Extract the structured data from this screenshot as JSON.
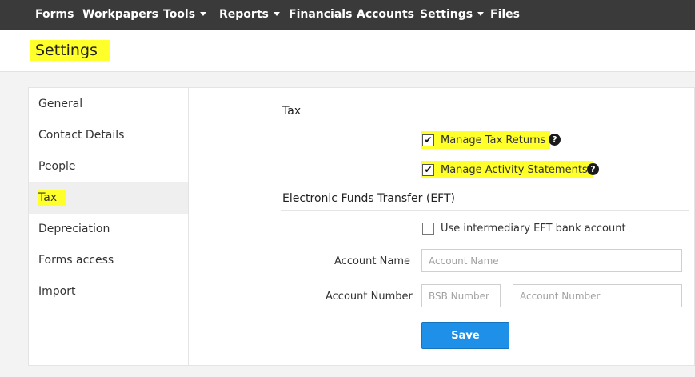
{
  "nav": {
    "forms": "Forms",
    "workpapers": "Workpapers",
    "tools": "Tools",
    "reports": "Reports",
    "financials": "Financials",
    "accounts": "Accounts",
    "settings": "Settings",
    "files": "Files"
  },
  "page": {
    "title": "Settings"
  },
  "sidebar": {
    "items": [
      {
        "label": "General"
      },
      {
        "label": "Contact Details"
      },
      {
        "label": "People"
      },
      {
        "label": "Tax",
        "active": true
      },
      {
        "label": "Depreciation"
      },
      {
        "label": "Forms access"
      },
      {
        "label": "Import"
      }
    ]
  },
  "tax": {
    "title": "Tax",
    "manage_tax_returns": {
      "label": "Manage Tax Returns",
      "checked": true
    },
    "manage_activity_statements": {
      "label": "Manage Activity Statements",
      "checked": true
    }
  },
  "eft": {
    "title": "Electronic Funds Transfer (EFT)",
    "use_intermediary": {
      "label": "Use intermediary EFT bank account",
      "checked": false
    },
    "account_name_label": "Account Name",
    "account_name_placeholder": "Account Name",
    "account_number_label": "Account Number",
    "bsb_placeholder": "BSB Number",
    "account_number_placeholder": "Account Number"
  },
  "actions": {
    "save_label": "Save"
  },
  "colors": {
    "nav_bg": "#3a3a3a",
    "highlight": "#ffff2a",
    "primary_button": "#1e90e8"
  },
  "icons": {
    "help": "question-circle-icon",
    "check": "check-icon",
    "caret": "caret-down-icon"
  }
}
